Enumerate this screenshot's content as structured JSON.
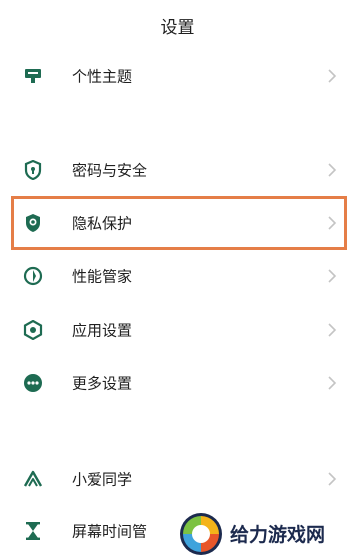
{
  "header": {
    "title": "设置"
  },
  "items": [
    {
      "label": "个性主题",
      "icon": "theme-icon"
    },
    {
      "label": "密码与安全",
      "icon": "shield-lock-icon"
    },
    {
      "label": "隐私保护",
      "icon": "privacy-shield-icon"
    },
    {
      "label": "性能管家",
      "icon": "performance-icon"
    },
    {
      "label": "应用设置",
      "icon": "app-settings-icon"
    },
    {
      "label": "更多设置",
      "icon": "more-settings-icon"
    },
    {
      "label": "小爱同学",
      "icon": "xiaoai-icon"
    },
    {
      "label": "屏幕时间管",
      "icon": "hourglass-icon"
    }
  ],
  "watermark": {
    "text": "给力游戏网"
  },
  "colors": {
    "accent": "#1e6b52",
    "highlight": "#e57e47",
    "chevron": "#c4c4c4",
    "text": "#202020"
  }
}
